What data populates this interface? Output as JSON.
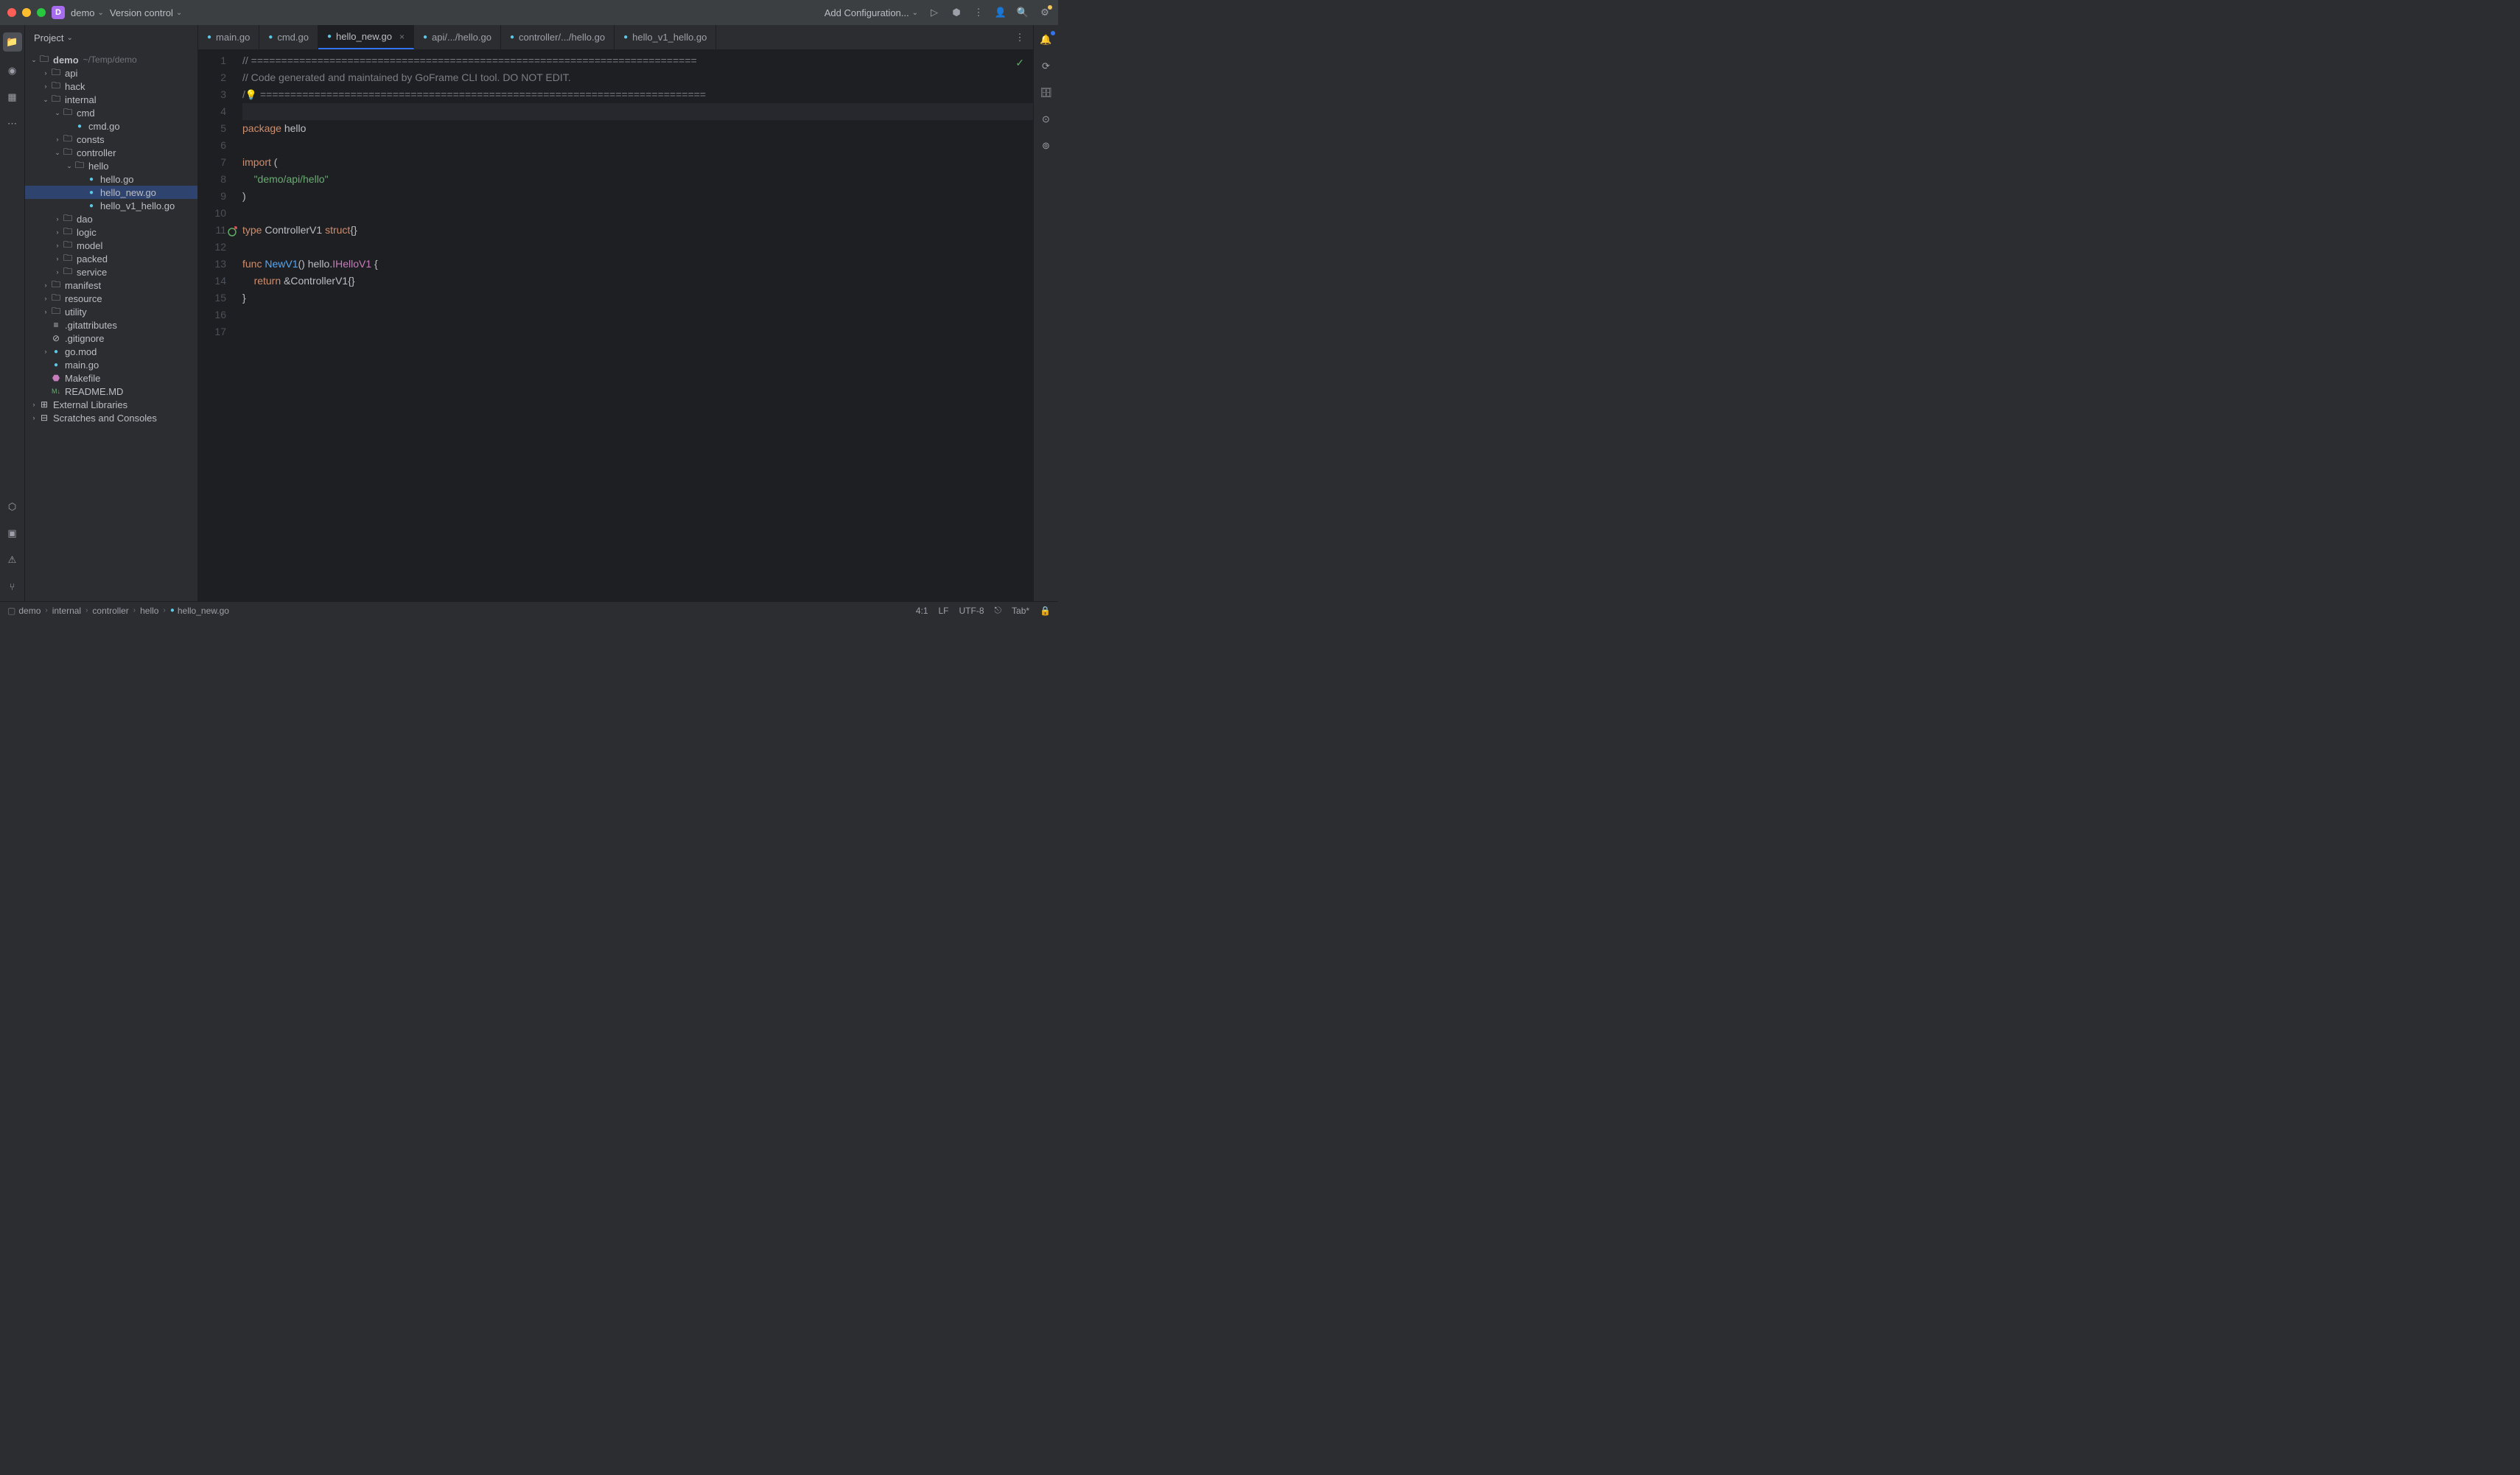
{
  "titlebar": {
    "project_name": "demo",
    "version_control": "Version control",
    "add_config": "Add Configuration..."
  },
  "project_panel": {
    "title": "Project",
    "root_name": "demo",
    "root_path": "~/Temp/demo",
    "tree": {
      "api": "api",
      "hack": "hack",
      "internal": "internal",
      "cmd": "cmd",
      "cmd_go": "cmd.go",
      "consts": "consts",
      "controller": "controller",
      "hello": "hello",
      "hello_go": "hello.go",
      "hello_new_go": "hello_new.go",
      "hello_v1_hello_go": "hello_v1_hello.go",
      "dao": "dao",
      "logic": "logic",
      "model": "model",
      "packed": "packed",
      "service": "service",
      "manifest": "manifest",
      "resource": "resource",
      "utility": "utility",
      "gitattributes": ".gitattributes",
      "gitignore": ".gitignore",
      "go_mod": "go.mod",
      "main_go": "main.go",
      "makefile": "Makefile",
      "readme": "README.MD",
      "external_libs": "External Libraries",
      "scratches": "Scratches and Consoles"
    }
  },
  "tabs": [
    {
      "label": "main.go"
    },
    {
      "label": "cmd.go"
    },
    {
      "label": "hello_new.go"
    },
    {
      "label": "api/.../hello.go"
    },
    {
      "label": "controller/.../hello.go"
    },
    {
      "label": "hello_v1_hello.go"
    }
  ],
  "code": {
    "line1": "// ==========================================================================",
    "line2": "// Code generated and maintained by GoFrame CLI tool. DO NOT EDIT.",
    "line3_prefix": "/",
    "line3_suffix": " ==========================================================================",
    "line5_package": "package",
    "line5_name": "hello",
    "line7_import": "import",
    "line8_path": "\"demo/api/hello\"",
    "line11_type": "type",
    "line11_name": "ControllerV1",
    "line11_struct": "struct",
    "line13_func": "func",
    "line13_name": "NewV1",
    "line13_pkg": "hello",
    "line13_ret": "IHelloV1",
    "line14_return": "return",
    "line14_ctrl": "ControllerV1"
  },
  "breadcrumb": {
    "demo": "demo",
    "internal": "internal",
    "controller": "controller",
    "hello": "hello",
    "file": "hello_new.go"
  },
  "status": {
    "position": "4:1",
    "line_sep": "LF",
    "encoding": "UTF-8",
    "indent": "Tab*"
  }
}
